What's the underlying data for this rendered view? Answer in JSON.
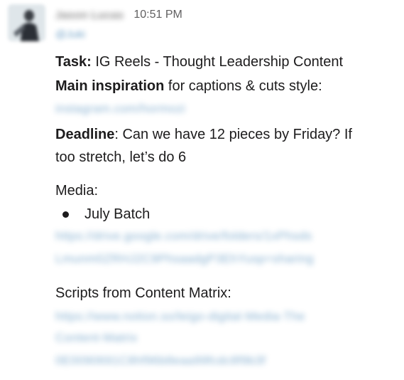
{
  "message": {
    "sender_name": "Jason Lucas",
    "timestamp": "10:51 PM",
    "mention": "@Juki",
    "task_label": "Task:",
    "task_value": " IG Reels - Thought Leadership Content",
    "inspiration_label": "Main inspiration",
    "inspiration_value": " for captions & cuts style:",
    "inspiration_link": "instagram.com/hormozi",
    "deadline_label": "Deadline",
    "deadline_line1": ": Can we have 12 pieces by Friday? If",
    "deadline_line2": "too stretch, let’s do 6",
    "media_label": "Media:",
    "media_item": "July Batch",
    "media_link_line1": "https://drive.google.com/drive/folders/1xPhsds",
    "media_link_line2": "Lmunm0ZRHJ2C9PhsaadgP3EhYusp=sharing",
    "scripts_label": "Scripts from Content Matrix:",
    "scripts_link_line1": "https://www.notion.so/leigo-digital-Media-The",
    "scripts_link_line2": "Content-Matrix",
    "scripts_link_line3": "0E0090691C8hf96b8eaa99fcdc8f9b3f"
  }
}
